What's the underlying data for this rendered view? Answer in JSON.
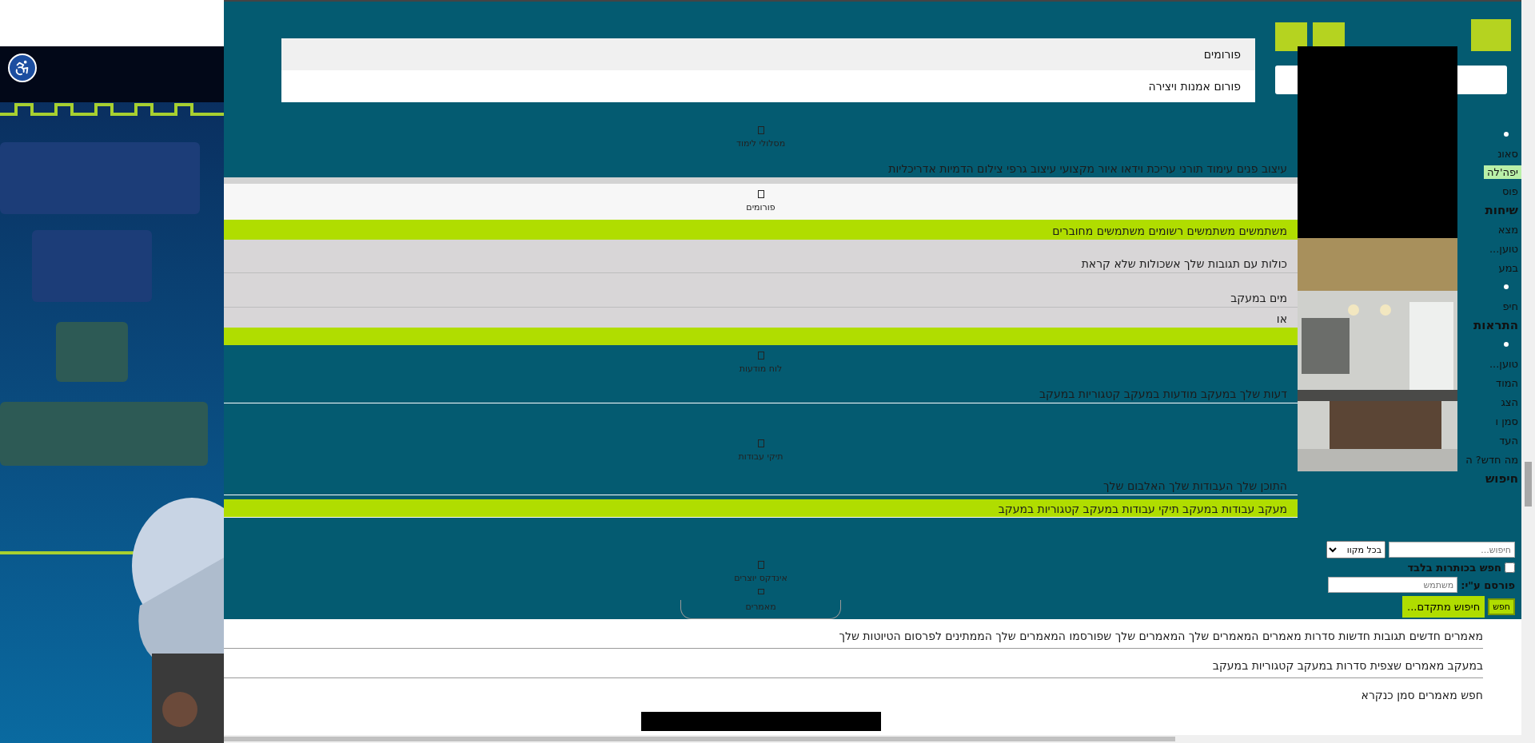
{
  "menu": [
    {
      "label": "פורומים",
      "selected": true
    },
    {
      "label": "פורום אמנות ויצירה",
      "selected": false
    }
  ],
  "sections": [
    {
      "kind": "nav",
      "label": "מסלולי לימוד",
      "color": "#045b71"
    },
    {
      "kind": "links",
      "text": "עיצוב פנים עימוד תורני עריכת וידאו איור מקצועי עיצוב גרפי צילום הדמיות אדריכליות",
      "color": "#045b71"
    },
    {
      "kind": "bar",
      "color": "#d3d3d3"
    },
    {
      "kind": "nav",
      "label": "פורומים",
      "color": "#f7f7f7"
    },
    {
      "kind": "links",
      "text": "משתמשים משתמשים רשומים משתמשים מחוברים",
      "color": "#b0dd00"
    },
    {
      "kind": "links",
      "text": "כולות עם תגובות שלך אשכולות שלא קראת",
      "color": "#d8d6d7"
    },
    {
      "kind": "links",
      "text": "מים במעקב",
      "color": "#d8d6d7"
    },
    {
      "kind": "links",
      "text": "או",
      "color": "#d8d6d7"
    },
    {
      "kind": "bar",
      "color": "#b0dd00"
    },
    {
      "kind": "nav",
      "label": "לוח מודעות",
      "color": "#045b71"
    },
    {
      "kind": "links",
      "text": "דעות שלך במעקב מודעות במעקב קטגוריות במעקב",
      "color": "#045b71"
    },
    {
      "kind": "nav",
      "label": "תיקי עבודות",
      "color": "#045b71"
    },
    {
      "kind": "links",
      "text": "התוכן שלך העבודות שלך האלבום שלך",
      "color": "#045b71"
    },
    {
      "kind": "links",
      "text": "מעקב עבודות במעקב תיקי עבודות במעקב קטגוריות במעקב",
      "color": "#b0dd00"
    },
    {
      "kind": "nav",
      "label": "אינדקס יוצרים",
      "color": "#045b71"
    },
    {
      "kind": "pill",
      "label": "מאמרים",
      "color": "#045b71"
    }
  ],
  "side_fragments": [
    {
      "kind": "bullet"
    },
    {
      "kind": "text",
      "text": "סאונ"
    },
    {
      "kind": "chip",
      "text": "יפה'לה"
    },
    {
      "kind": "text",
      "text": "פוס"
    },
    {
      "kind": "heading",
      "text": "שיחות"
    },
    {
      "kind": "text",
      "text": "מצא"
    },
    {
      "kind": "text",
      "text": "טוען..."
    },
    {
      "kind": "text",
      "text": "במע"
    },
    {
      "kind": "bullet"
    },
    {
      "kind": "text",
      "text": "חיפ"
    },
    {
      "kind": "heading",
      "text": "התראות"
    },
    {
      "kind": "bullet"
    },
    {
      "kind": "text",
      "text": "טוען..."
    },
    {
      "kind": "text",
      "text": "המוד"
    },
    {
      "kind": "item",
      "text": "הצג"
    },
    {
      "kind": "item",
      "text": "סמן ו"
    },
    {
      "kind": "item",
      "text": "העד"
    },
    {
      "kind": "text",
      "text": "מה חדש? ה"
    },
    {
      "kind": "heading",
      "text": "חיפוש"
    }
  ],
  "search": {
    "placeholder": "חיפוש...",
    "scope": "בכל מקוו",
    "titles_only": {
      "label": "חפש בכותרות בלבד",
      "checked": false
    },
    "author_label": "פורסם ע\"י:",
    "author_placeholder": "משתמש",
    "submit": "חפש",
    "advanced": "חיפוש מתקדם..."
  },
  "article_links": [
    "מאמרים חדשים תגובות חדשות סדרות מאמרים המאמרים שלך המאמרים שלך שפורסמו המאמרים שלך הממתינים לפרסום הטיוטות שלך",
    "במעקב מאמרים שצפית סדרות במעקב קטגוריות במעקב",
    "חפש מאמרים סמן כנקרא"
  ]
}
